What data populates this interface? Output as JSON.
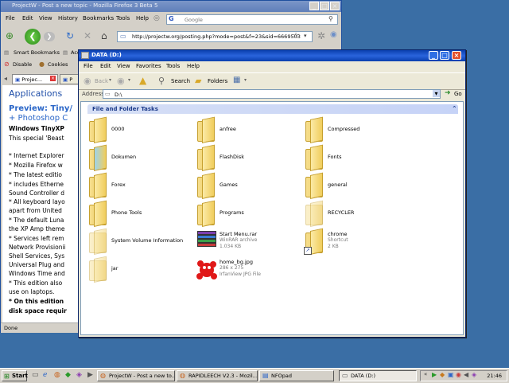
{
  "firefox": {
    "title": "ProjectW - Post a new topic - Mozilla Firefox 3 Beta 5",
    "menu": [
      "File",
      "Edit",
      "View",
      "History",
      "Bookmarks",
      "Tools",
      "Help"
    ],
    "search_placeholder": "Google",
    "url": "http://projectw.org/posting.php?mode=post&f=23&sid=6669503",
    "bookmarks": [
      "Smart Bookmarks",
      "Acc"
    ],
    "toolbar2": [
      "Disable",
      "Cookies"
    ],
    "tabs": [
      "Projec...",
      "P"
    ],
    "content": {
      "heading": "Applications",
      "preview_title": "Preview: Tiny/",
      "preview_title2": "+ Photoshop C",
      "lines": [
        "Windows TinyXP",
        "This special 'Beast",
        "* Internet Explorer",
        "* Mozilla Firefox w",
        "* The latest editio",
        "* includes Etherne",
        "Sound Controller d",
        "* All keyboard layo",
        "apart from United",
        "* The default Luna",
        "the XP Amp theme",
        "* Services left rem",
        "Network Provisionii",
        "Shell Services, Sys",
        "Universal Plug and",
        "Windows Time and",
        "* This edition also",
        "use on laptops.",
        "* On this edition",
        "disk space requir"
      ]
    },
    "status": "Done"
  },
  "explorer": {
    "title": "DATA (D:)",
    "menu": [
      "File",
      "Edit",
      "View",
      "Favorites",
      "Tools",
      "Help"
    ],
    "toolbar": {
      "back": "Back",
      "search": "Search",
      "folders": "Folders"
    },
    "address_label": "Address",
    "address": "D:\\",
    "go_label": "Go",
    "tasks_header": "File and Folder Tasks",
    "items": [
      {
        "name": "0000",
        "type": "folder"
      },
      {
        "name": "anfree",
        "type": "folder"
      },
      {
        "name": "Compressed",
        "type": "folder"
      },
      {
        "name": "Dokumen",
        "type": "folder"
      },
      {
        "name": "FlashDisk",
        "type": "folder"
      },
      {
        "name": "Fonts",
        "type": "folder"
      },
      {
        "name": "Forex",
        "type": "folder"
      },
      {
        "name": "Games",
        "type": "folder"
      },
      {
        "name": "general",
        "type": "folder"
      },
      {
        "name": "Phone Tools",
        "type": "folder"
      },
      {
        "name": "Programs",
        "type": "folder"
      },
      {
        "name": "RECYCLER",
        "type": "folder-faded"
      },
      {
        "name": "System Volume Information",
        "type": "folder-faded"
      },
      {
        "name": "Start Menu.rar",
        "type": "rar",
        "sub1": "WinRAR archive",
        "sub2": "1.034 KB"
      },
      {
        "name": "chrome",
        "type": "shortcut",
        "sub1": "Shortcut",
        "sub2": "2 KB"
      },
      {
        "name": "jar",
        "type": "folder-faded"
      },
      {
        "name": "home_bg.jpg",
        "type": "jpg",
        "sub1": "286 x 275",
        "sub2": "IrfanView JPG File"
      }
    ]
  },
  "taskbar": {
    "start": "Start",
    "buttons": [
      "ProjectW - Post a new to...",
      "RAPIDLEECH V2.3 - Mozil...",
      "NFOpad",
      "DATA (D:)"
    ],
    "clock": "21:46"
  }
}
